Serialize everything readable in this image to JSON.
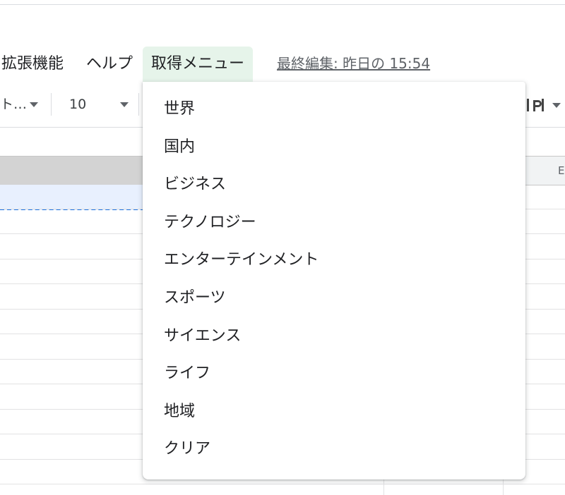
{
  "menubar": {
    "extensions": "拡張機能",
    "help": "ヘルプ",
    "custom_menu": "取得メニュー",
    "last_edit": "最終編集: 昨日の 15:54"
  },
  "toolbar": {
    "font_truncated": "ト…",
    "font_size": "10"
  },
  "grid": {
    "col_header_partial": "E"
  },
  "dropdown": {
    "items": [
      "世界",
      "国内",
      "ビジネス",
      "テクノロジー",
      "エンターテインメント",
      "スポーツ",
      "サイエンス",
      "ライフ",
      "地域",
      "クリア"
    ]
  },
  "colors": {
    "active_menu_bg": "#e6f4ea",
    "selection_blue": "#1a73e8"
  }
}
